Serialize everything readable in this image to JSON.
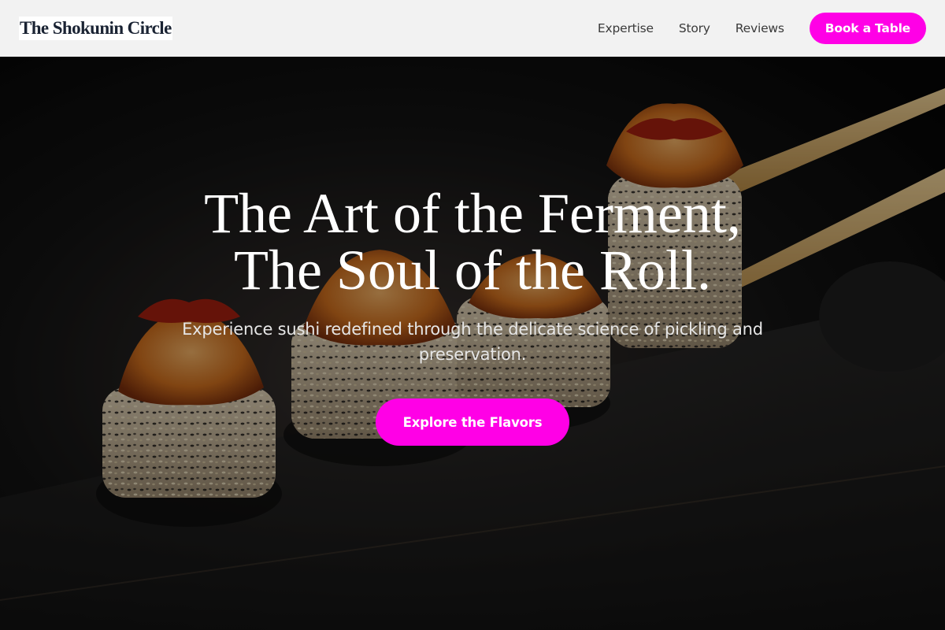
{
  "header": {
    "brand": "The Shokunin Circle",
    "nav": [
      {
        "label": "Expertise"
      },
      {
        "label": "Story"
      },
      {
        "label": "Reviews"
      }
    ],
    "cta_label": "Book a Table"
  },
  "hero": {
    "title_line1": "The Art of the Ferment,",
    "title_line2": "The Soul of the Roll.",
    "subtitle": "Experience sushi redefined through the delicate science of pickling and preservation.",
    "cta_label": "Explore the Flavors",
    "image_subject": "sushi rolls with chopsticks on dark slate"
  },
  "colors": {
    "accent": "#ff00e6",
    "nav_background": "#f2f2f2",
    "brand_text": "#1a2333",
    "hero_background": "#000000"
  }
}
